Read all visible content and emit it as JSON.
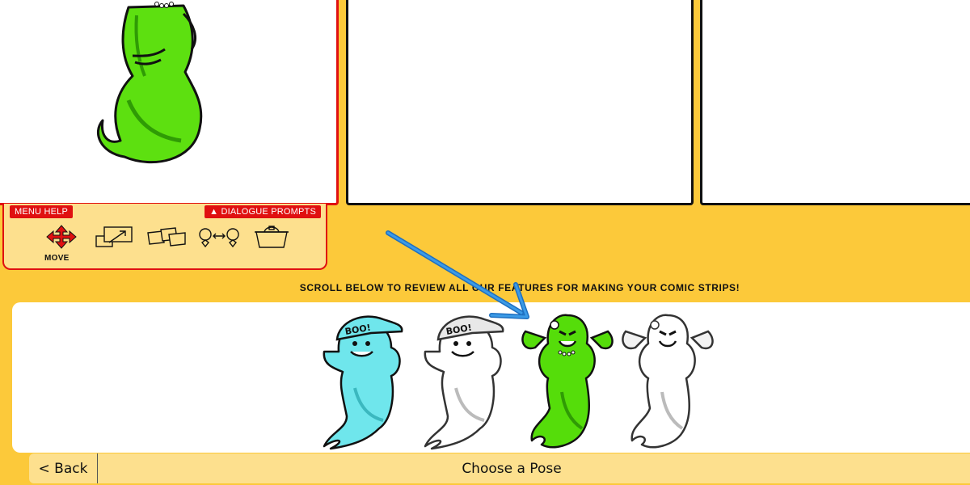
{
  "menu": {
    "menu_help_label": "MENU HELP",
    "dialogue_prompts_label": "▲ DIALOGUE PROMPTS",
    "tools": [
      {
        "icon": "move-arrows-icon",
        "label": "MOVE"
      },
      {
        "icon": "resize-icon"
      },
      {
        "icon": "flip-icon"
      },
      {
        "icon": "swap-characters-icon"
      },
      {
        "icon": "delete-basket-icon"
      }
    ]
  },
  "scroll_hint": "SCROLL BELOW TO REVIEW ALL OUR FEATURES FOR MAKING YOUR COMIC STRIPS!",
  "poses": [
    {
      "name": "boo-cap-ghost",
      "color": "#6fe6ec",
      "selected": true
    },
    {
      "name": "boo-cap-ghost",
      "color": "#ffffff",
      "selected": false
    },
    {
      "name": "pigtail-ghost",
      "color": "#55dd0a",
      "selected": true
    },
    {
      "name": "pigtail-ghost",
      "color": "#ffffff",
      "selected": false
    }
  ],
  "cap_text": "BOO!",
  "bottom_bar": {
    "back_label": "< Back",
    "title": "Choose a Pose"
  },
  "colors": {
    "background": "#fcc93a",
    "accent_red": "#e01010",
    "ghost_green": "#55dd0a",
    "ghost_cyan": "#6fe6ec",
    "arrow_blue": "#2b86d6"
  }
}
